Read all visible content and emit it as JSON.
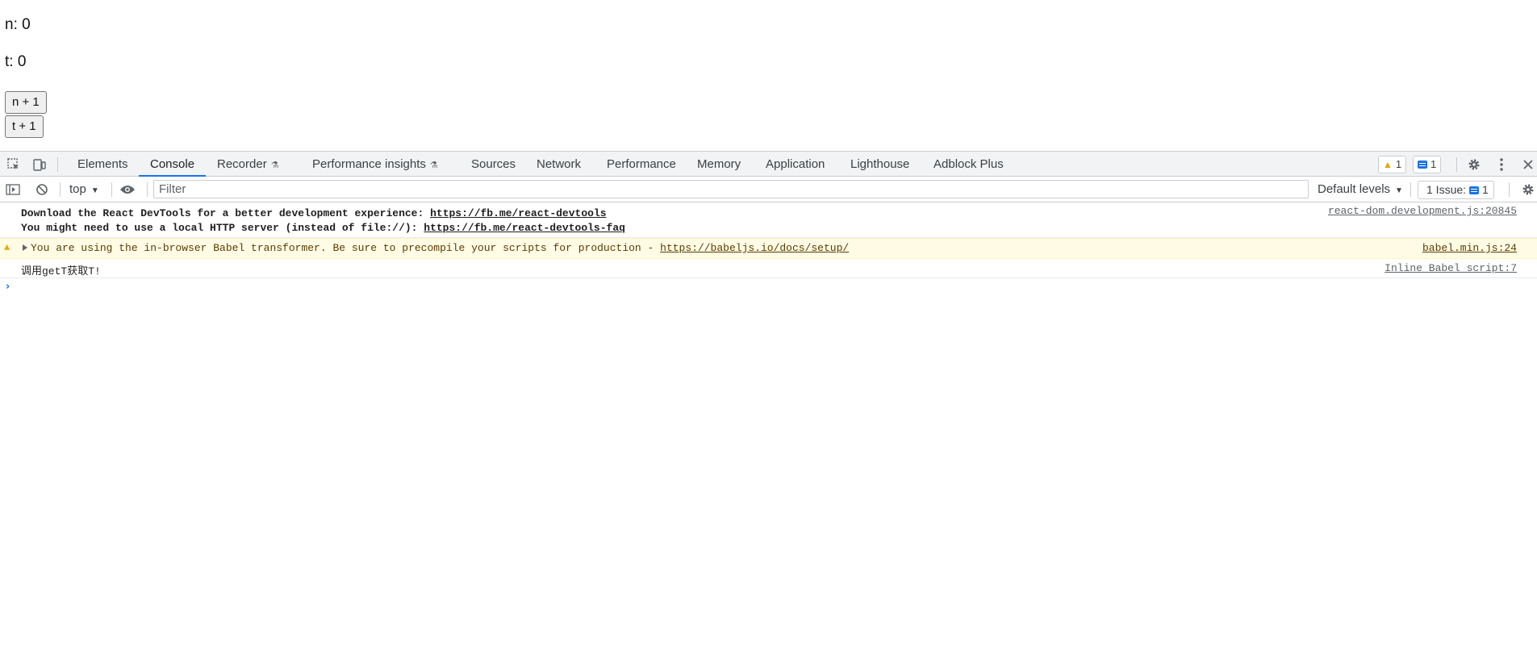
{
  "page": {
    "n_line": "n: 0",
    "t_line": "t: 0",
    "n_button": "n + 1",
    "t_button": "t + 1"
  },
  "devtools": {
    "tabs": [
      {
        "label": "Elements",
        "active": false
      },
      {
        "label": "Console",
        "active": true
      },
      {
        "label": "Recorder",
        "active": false,
        "experimental": true
      },
      {
        "label": "Performance insights",
        "active": false,
        "experimental": true
      },
      {
        "label": "Sources",
        "active": false
      },
      {
        "label": "Network",
        "active": false
      },
      {
        "label": "Performance",
        "active": false
      },
      {
        "label": "Memory",
        "active": false
      },
      {
        "label": "Application",
        "active": false
      },
      {
        "label": "Lighthouse",
        "active": false
      },
      {
        "label": "Adblock Plus",
        "active": false
      }
    ],
    "warning_count": "1",
    "message_count": "1",
    "icons": [
      "inspect-element-icon",
      "device-toolbar-icon",
      "settings-gear-icon",
      "more-menu-icon",
      "close-icon"
    ],
    "accent_color": "#1a73e8",
    "warning_color": "#e8a600"
  },
  "console": {
    "context": "top",
    "filter_placeholder": "Filter",
    "levels": "Default levels",
    "issues_label": "1 Issue:",
    "issues_count": "1",
    "messages": {
      "info": {
        "line1_text": "Download the React DevTools for a better development experience: ",
        "line1_link": "https://fb.me/react-devtools",
        "line2_text": "You might need to use a local HTTP server (instead of file://): ",
        "line2_link": "https://fb.me/react-devtools-faq",
        "source": "react-dom.development.js:20845"
      },
      "warn": {
        "text": "You are using the in-browser Babel transformer. Be sure to precompile your scripts for production - ",
        "link": "https://babeljs.io/docs/setup/",
        "source": "babel.min.js:24"
      },
      "log": {
        "text": "调用getT获取T!",
        "source": "Inline Babel script:7"
      }
    }
  }
}
